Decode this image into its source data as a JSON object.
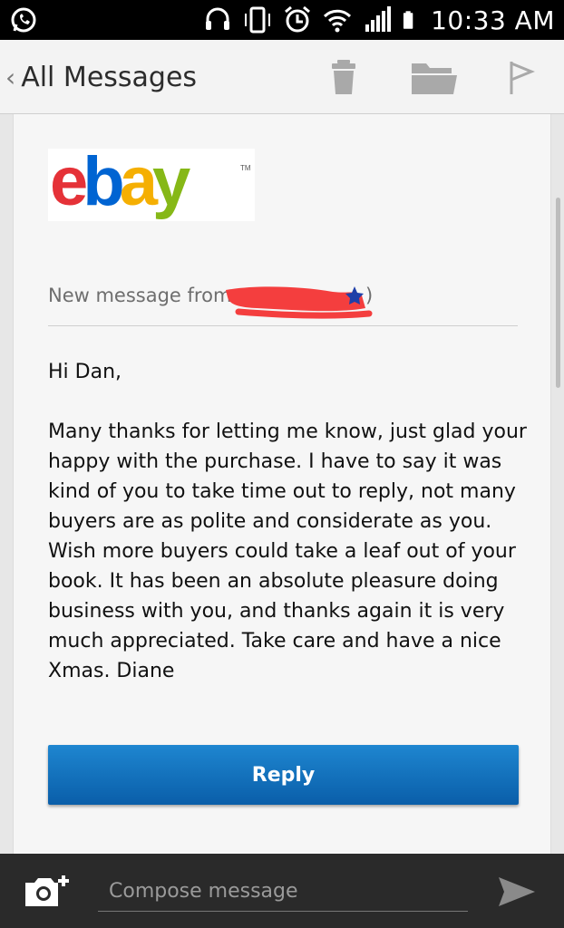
{
  "status_bar": {
    "time": "10:33 AM",
    "icons": [
      "whatsapp-icon",
      "headset-icon",
      "vibrate-icon",
      "alarm-icon",
      "wifi-icon",
      "signal-icon",
      "battery-icon"
    ]
  },
  "app_bar": {
    "back_label": "All Messages",
    "actions": [
      "trash-icon",
      "folder-icon",
      "flag-icon"
    ]
  },
  "message": {
    "logo": "ebay",
    "from_label": "New message from:",
    "from_suffix": ")",
    "greeting": "Hi Dan,",
    "body": "Many thanks for letting me know, just glad your happy with the purchase. I have to say it was kind of you to take time out to reply, not many buyers are as polite and considerate as you. Wish more buyers could take a leaf out of your book. It has been an absolute pleasure doing business with you, and thanks again it is very much appreciated. Take care and have a nice Xmas. Diane",
    "reply_label": "Reply"
  },
  "compose": {
    "placeholder": "Compose message",
    "value": ""
  },
  "colors": {
    "reply_button": "#0a5ea9",
    "redaction": "#f43e3e",
    "ebay_red": "#e53238",
    "ebay_blue": "#0064d2",
    "ebay_yellow": "#f5af02",
    "ebay_green": "#86b817"
  }
}
